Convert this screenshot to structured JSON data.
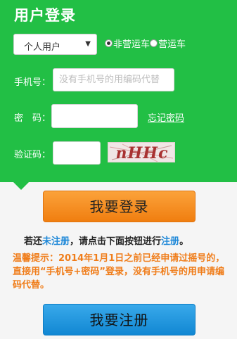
{
  "header": {
    "title": "用户登录"
  },
  "user_type": {
    "selected": "个人用户"
  },
  "vehicle_type": {
    "options": [
      {
        "label": "非营运车",
        "checked": true
      },
      {
        "label": "营运车",
        "checked": false
      }
    ]
  },
  "form": {
    "phone_label": "手机号：",
    "phone_placeholder": "没有手机号的用编码代替",
    "password_label": "密　码：",
    "forgot_link": "忘记密码",
    "captcha_label": "验证码：",
    "captcha_text": "nHHc"
  },
  "buttons": {
    "login": "我要登录",
    "register": "我要注册"
  },
  "register_hint": {
    "prefix": "若还",
    "link1": "未注册",
    "middle": "，请点击下面按钮进行",
    "link2": "注册",
    "suffix": "。"
  },
  "notice": "温馨提示：2014年1月1日之前已经申请过摇号的，直接用“手机号+密码”登录，没有手机号的用申请编码代替。",
  "colors": {
    "panel": "#22bf45",
    "login": "#f5921d",
    "register": "#1a96dd",
    "notice": "#f07d1a",
    "link": "#1e88d8"
  }
}
